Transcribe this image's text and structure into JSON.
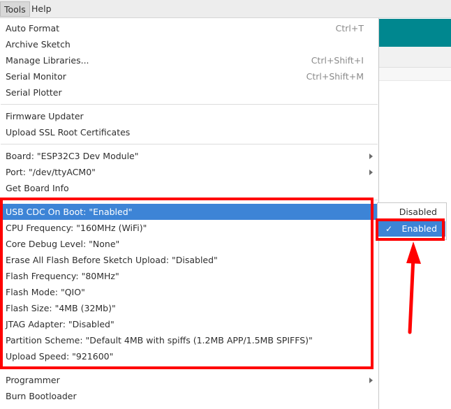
{
  "menubar": {
    "tools": "Tools",
    "help": "Help"
  },
  "tools_menu": {
    "auto_format": {
      "label": "Auto Format",
      "shortcut": "Ctrl+T"
    },
    "archive_sketch": {
      "label": "Archive Sketch"
    },
    "manage_libraries": {
      "label": "Manage Libraries...",
      "shortcut": "Ctrl+Shift+I"
    },
    "serial_monitor": {
      "label": "Serial Monitor",
      "shortcut": "Ctrl+Shift+M"
    },
    "serial_plotter": {
      "label": "Serial Plotter"
    },
    "firmware_updater": {
      "label": "Firmware Updater"
    },
    "upload_ssl": {
      "label": "Upload SSL Root Certificates"
    },
    "board": {
      "label": "Board: \"ESP32C3 Dev Module\""
    },
    "port": {
      "label": "Port: \"/dev/ttyACM0\""
    },
    "get_board_info": {
      "label": "Get Board Info"
    },
    "usb_cdc": {
      "label": "USB CDC On Boot: \"Enabled\""
    },
    "cpu_freq": {
      "label": "CPU Frequency: \"160MHz (WiFi)\""
    },
    "core_debug": {
      "label": "Core Debug Level: \"None\""
    },
    "erase_flash": {
      "label": "Erase All Flash Before Sketch Upload: \"Disabled\""
    },
    "flash_freq": {
      "label": "Flash Frequency: \"80MHz\""
    },
    "flash_mode": {
      "label": "Flash Mode: \"QIO\""
    },
    "flash_size": {
      "label": "Flash Size: \"4MB (32Mb)\""
    },
    "jtag": {
      "label": "JTAG Adapter: \"Disabled\""
    },
    "partition": {
      "label": "Partition Scheme: \"Default 4MB with spiffs (1.2MB APP/1.5MB SPIFFS)\""
    },
    "upload_speed": {
      "label": "Upload Speed: \"921600\""
    },
    "programmer": {
      "label": "Programmer"
    },
    "burn_bootloader": {
      "label": "Burn Bootloader"
    }
  },
  "usb_cdc_submenu": {
    "disabled": "Disabled",
    "enabled": "Enabled",
    "check": "✓"
  },
  "colors": {
    "highlight": "#3d84d6",
    "annotation": "#ff0000",
    "teal": "#00878f"
  }
}
